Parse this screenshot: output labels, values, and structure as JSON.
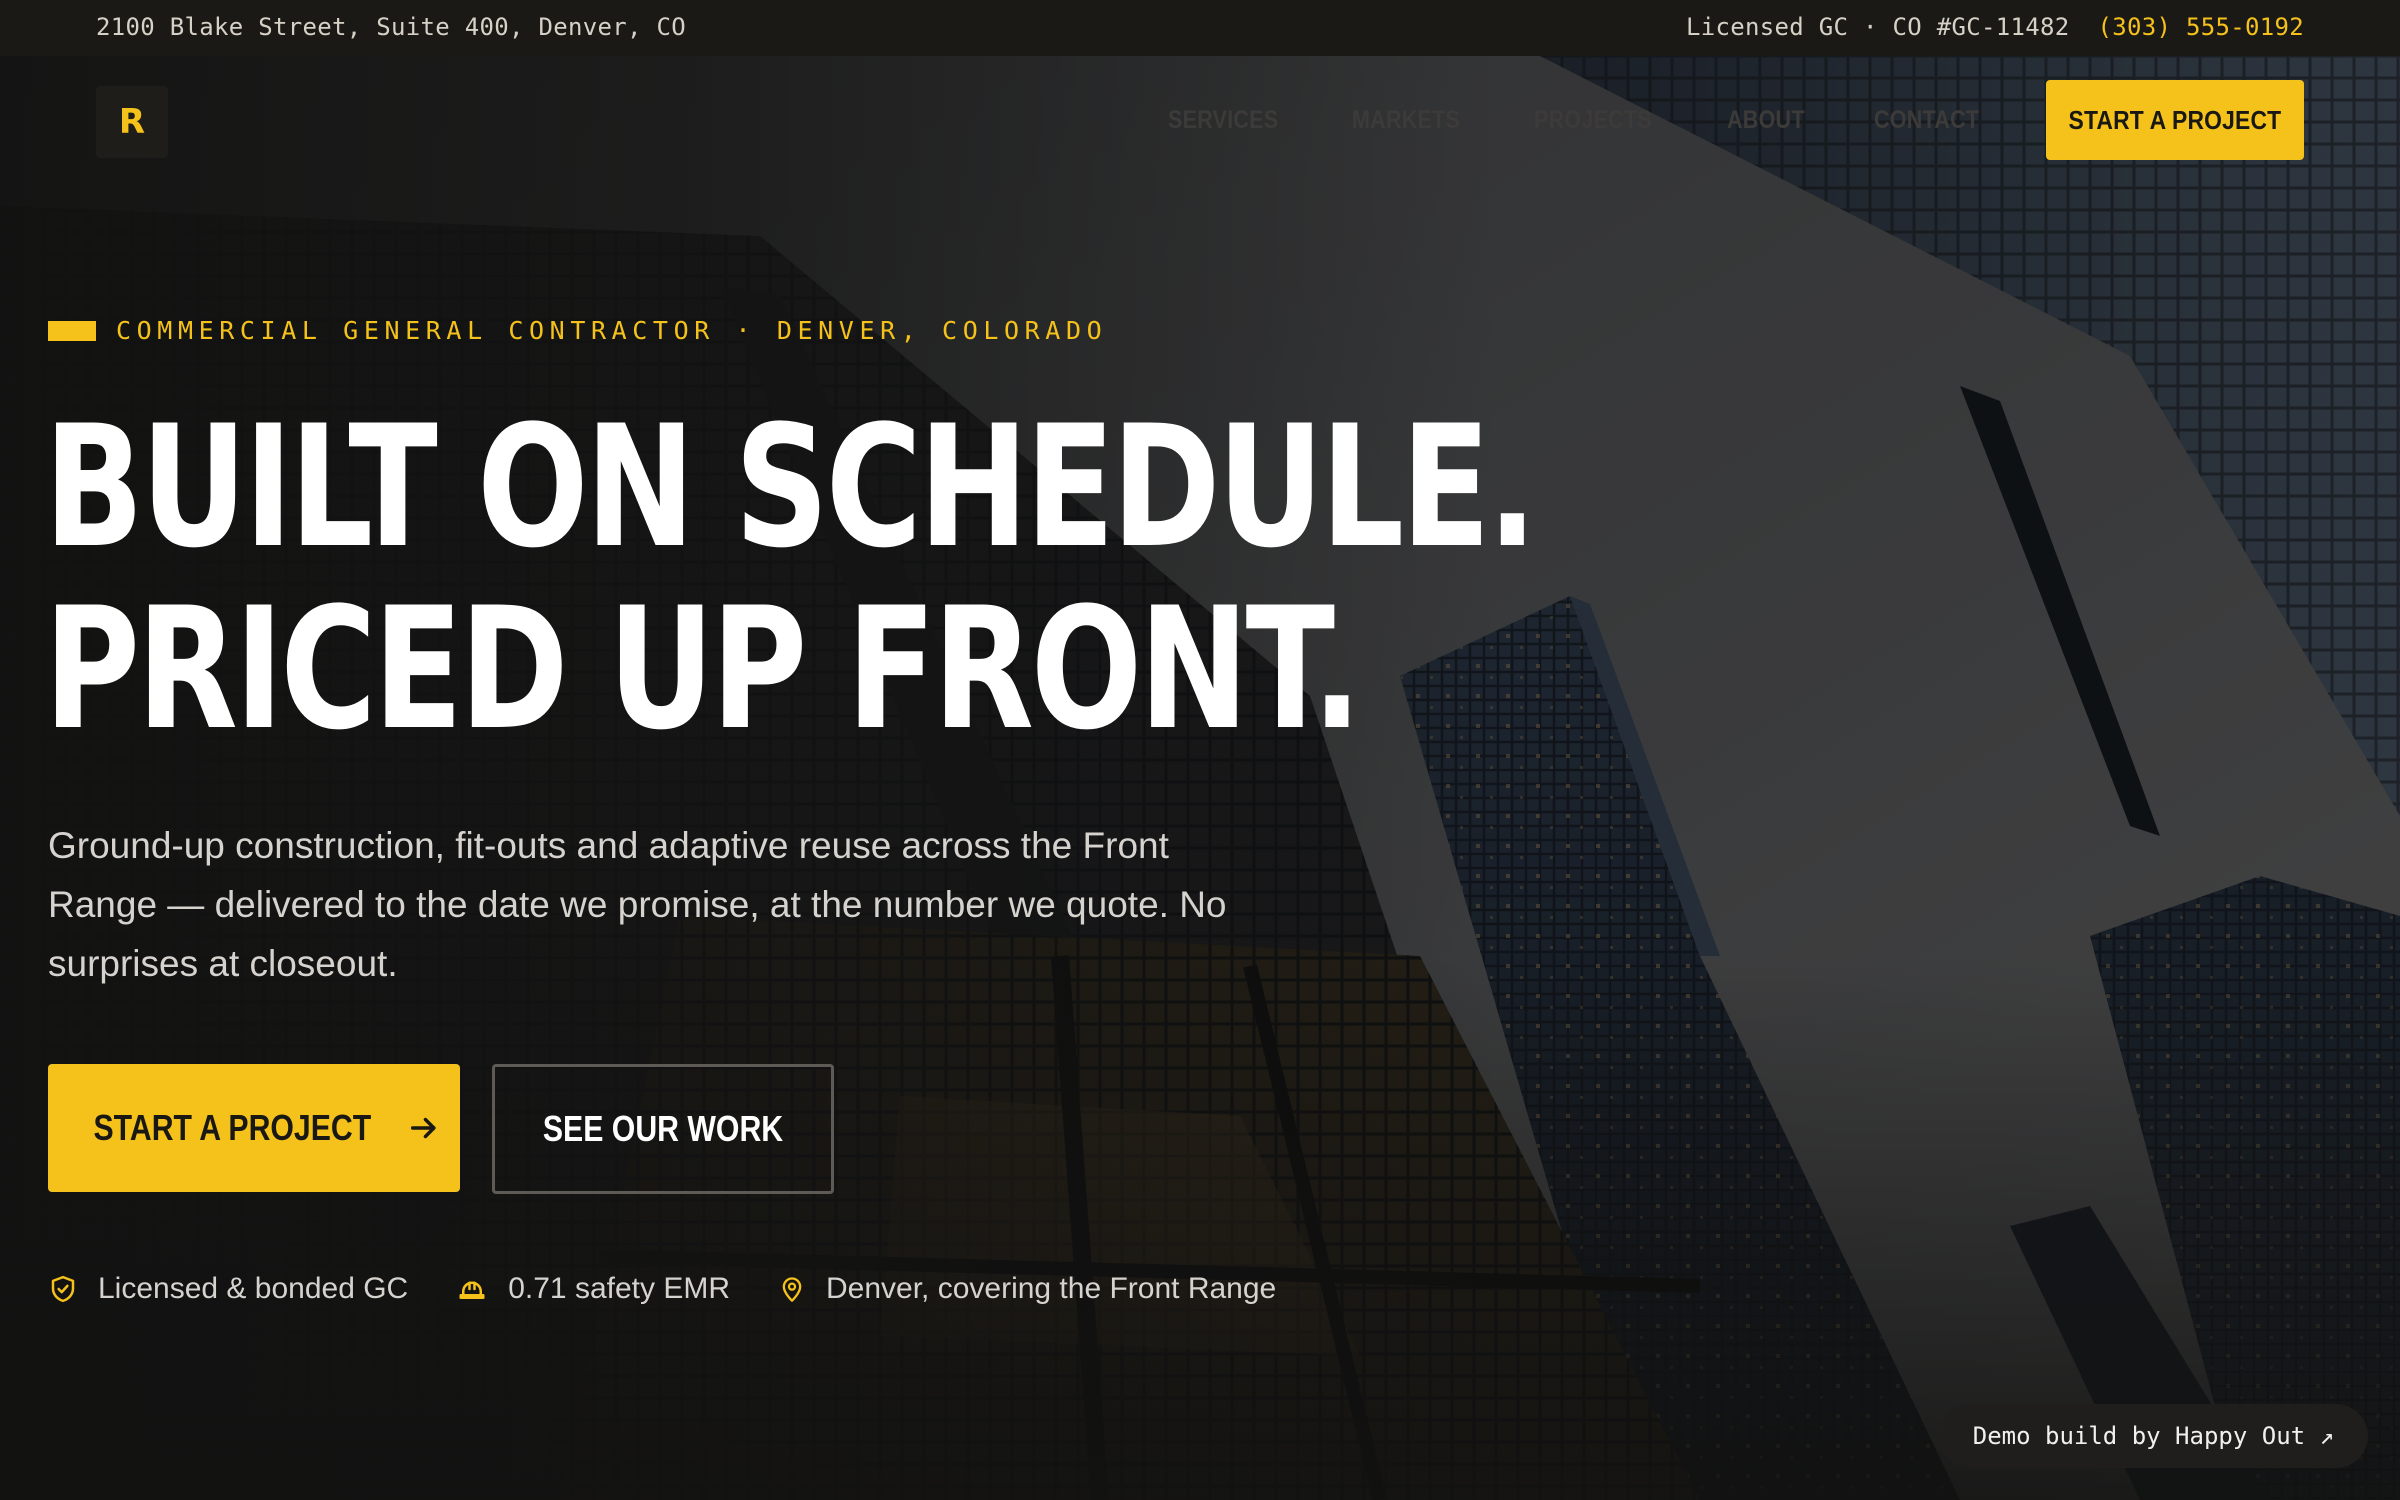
{
  "topbar": {
    "address": "2100 Blake Street, Suite 400, Denver, CO",
    "license": "Licensed GC · CO #GC-11482",
    "phone": "(303) 555-0192"
  },
  "nav": {
    "logo_letter": "R",
    "links": [
      "SERVICES",
      "MARKETS",
      "PROJECTS",
      "ABOUT",
      "CONTACT"
    ],
    "cta": "START A PROJECT"
  },
  "hero": {
    "eyebrow": "COMMERCIAL GENERAL CONTRACTOR · DENVER, COLORADO",
    "headline_line1": "BUILT ON SCHEDULE.",
    "headline_line2": "PRICED UP FRONT.",
    "subtext": "Ground-up construction, fit-outs and adaptive reuse across the Front Range — delivered to the date we promise, at the number we quote. No surprises at closeout.",
    "primary_button": "START A PROJECT",
    "secondary_button": "SEE OUR WORK",
    "badges": [
      {
        "icon": "shield-check-icon",
        "label": "Licensed & bonded GC"
      },
      {
        "icon": "hard-hat-icon",
        "label": "0.71 safety EMR"
      },
      {
        "icon": "map-pin-icon",
        "label": "Denver, covering the Front Range"
      }
    ]
  },
  "demo_pill": "Demo build by Happy Out ↗",
  "colors": {
    "accent": "#f5c21b",
    "background": "#151412",
    "topbar": "#1b1916"
  }
}
